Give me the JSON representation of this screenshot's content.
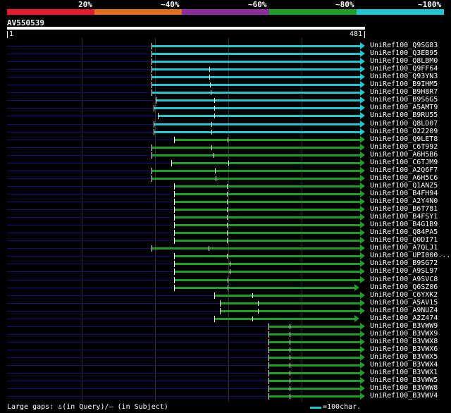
{
  "scale": {
    "labels": [
      "20%",
      "~40%",
      "~60%",
      "~80%",
      "~100%"
    ],
    "colors": [
      "#e8182d",
      "#e0701e",
      "#8c2e9e",
      "#1e9e28",
      "#1ec8d2"
    ]
  },
  "query": {
    "id": "AV550539",
    "start": "1",
    "end": "481",
    "length": 481
  },
  "colors": {
    "cyan": "#1ec8d2",
    "green": "#1e9e28",
    "row_line": "#12126e"
  },
  "hits": [
    {
      "label": "UniRef100_Q9SG83",
      "start": 195,
      "end": 481,
      "color": "cyan",
      "arrow": true,
      "gaps": []
    },
    {
      "label": "UniRef100_Q3EB95",
      "start": 195,
      "end": 481,
      "color": "cyan",
      "arrow": true,
      "gaps": []
    },
    {
      "label": "UniRef100_Q8LBM0",
      "start": 195,
      "end": 481,
      "color": "cyan",
      "arrow": true,
      "gaps": []
    },
    {
      "label": "UniRef100_Q9FF64",
      "start": 195,
      "end": 481,
      "color": "cyan",
      "arrow": true,
      "gaps": [
        273
      ]
    },
    {
      "label": "UniRef100_Q93YN3",
      "start": 195,
      "end": 481,
      "color": "cyan",
      "arrow": true,
      "gaps": [
        273
      ]
    },
    {
      "label": "UniRef100_B9IHM5",
      "start": 195,
      "end": 481,
      "color": "cyan",
      "arrow": true,
      "gaps": [
        274
      ]
    },
    {
      "label": "UniRef100_B9H8R7",
      "start": 195,
      "end": 481,
      "color": "cyan",
      "arrow": true,
      "gaps": [
        275
      ]
    },
    {
      "label": "UniRef100_B9S6G5",
      "start": 201,
      "end": 481,
      "color": "cyan",
      "arrow": true,
      "gaps": [
        279
      ]
    },
    {
      "label": "UniRef100_A5AMT9",
      "start": 198,
      "end": 481,
      "color": "cyan",
      "arrow": true,
      "gaps": [
        279
      ]
    },
    {
      "label": "UniRef100_B9RU55",
      "start": 204,
      "end": 481,
      "color": "cyan",
      "arrow": true,
      "gaps": [
        279
      ]
    },
    {
      "label": "UniRef100_Q8LD07",
      "start": 198,
      "end": 481,
      "color": "cyan",
      "arrow": true,
      "gaps": [
        276
      ]
    },
    {
      "label": "UniRef100_O22209",
      "start": 198,
      "end": 481,
      "color": "cyan",
      "arrow": true,
      "gaps": [
        276
      ]
    },
    {
      "label": "UniRef100_Q9LET8",
      "start": 225,
      "end": 481,
      "color": "green",
      "arrow": true,
      "gaps": [
        297
      ]
    },
    {
      "label": "UniRef100_C6T992",
      "start": 195,
      "end": 481,
      "color": "green",
      "arrow": true,
      "gaps": [
        276
      ]
    },
    {
      "label": "UniRef100_A6H5B6",
      "start": 195,
      "end": 481,
      "color": "green",
      "arrow": true,
      "gaps": [
        278
      ]
    },
    {
      "label": "UniRef100_C6TJM9",
      "start": 222,
      "end": 481,
      "color": "green",
      "arrow": true,
      "gaps": [
        298
      ]
    },
    {
      "label": "UniRef100_A2Q6F7",
      "start": 195,
      "end": 481,
      "color": "green",
      "arrow": true,
      "gaps": [
        280
      ]
    },
    {
      "label": "UniRef100_A6H5C6",
      "start": 195,
      "end": 481,
      "color": "green",
      "arrow": true,
      "gaps": [
        281
      ]
    },
    {
      "label": "UniRef100_Q1ANZ5",
      "start": 225,
      "end": 481,
      "color": "green",
      "arrow": true,
      "gaps": [
        296
      ]
    },
    {
      "label": "UniRef100_B4FH94",
      "start": 225,
      "end": 481,
      "color": "green",
      "arrow": true,
      "gaps": [
        296
      ]
    },
    {
      "label": "UniRef100_A2Y4N0",
      "start": 225,
      "end": 481,
      "color": "green",
      "arrow": true,
      "gaps": [
        296
      ]
    },
    {
      "label": "UniRef100_B6T781",
      "start": 225,
      "end": 481,
      "color": "green",
      "arrow": true,
      "gaps": [
        296
      ]
    },
    {
      "label": "UniRef100_B4FSY1",
      "start": 225,
      "end": 481,
      "color": "green",
      "arrow": true,
      "gaps": [
        296
      ]
    },
    {
      "label": "UniRef100_B4G1B9",
      "start": 225,
      "end": 481,
      "color": "green",
      "arrow": true,
      "gaps": [
        296
      ]
    },
    {
      "label": "UniRef100_Q84PA5",
      "start": 225,
      "end": 481,
      "color": "green",
      "arrow": true,
      "gaps": [
        296
      ]
    },
    {
      "label": "UniRef100_Q0DI71",
      "start": 225,
      "end": 481,
      "color": "green",
      "arrow": true,
      "gaps": [
        296
      ]
    },
    {
      "label": "UniRef100_A7QLJ1",
      "start": 195,
      "end": 481,
      "color": "green",
      "arrow": true,
      "gaps": [
        272
      ]
    },
    {
      "label": "UniRef100_UPI000...",
      "start": 225,
      "end": 481,
      "color": "green",
      "arrow": true,
      "gaps": [
        296
      ]
    },
    {
      "label": "UniRef100_B9SG72",
      "start": 225,
      "end": 481,
      "color": "green",
      "arrow": true,
      "gaps": [
        300
      ]
    },
    {
      "label": "UniRef100_A9SL97",
      "start": 225,
      "end": 481,
      "color": "green",
      "arrow": true,
      "gaps": [
        300
      ]
    },
    {
      "label": "UniRef100_A9SVC8",
      "start": 225,
      "end": 481,
      "color": "green",
      "arrow": true,
      "gaps": [
        297
      ]
    },
    {
      "label": "UniRef100_Q6SZ06",
      "start": 225,
      "end": 473,
      "color": "green",
      "arrow": true,
      "gaps": [
        297
      ]
    },
    {
      "label": "UniRef100_C6YXK2",
      "start": 279,
      "end": 481,
      "color": "green",
      "arrow": true,
      "gaps": [
        330
      ]
    },
    {
      "label": "UniRef100_A5AV15",
      "start": 287,
      "end": 481,
      "color": "green",
      "arrow": true,
      "gaps": [
        338
      ]
    },
    {
      "label": "UniRef100_A9NUZ4",
      "start": 287,
      "end": 481,
      "color": "green",
      "arrow": true,
      "gaps": [
        338
      ]
    },
    {
      "label": "UniRef100_A2Z474",
      "start": 279,
      "end": 473,
      "color": "green",
      "arrow": true,
      "gaps": [
        330
      ]
    },
    {
      "label": "UniRef100_B3VWW9",
      "start": 352,
      "end": 481,
      "color": "green",
      "arrow": true,
      "gaps": [
        381
      ]
    },
    {
      "label": "UniRef100_B3VWX9",
      "start": 352,
      "end": 481,
      "color": "green",
      "arrow": true,
      "gaps": [
        381
      ]
    },
    {
      "label": "UniRef100_B3VWX8",
      "start": 352,
      "end": 481,
      "color": "green",
      "arrow": true,
      "gaps": [
        381
      ]
    },
    {
      "label": "UniRef100_B3VWX6",
      "start": 352,
      "end": 481,
      "color": "green",
      "arrow": true,
      "gaps": [
        381
      ]
    },
    {
      "label": "UniRef100_B3VWX5",
      "start": 352,
      "end": 481,
      "color": "green",
      "arrow": true,
      "gaps": [
        381
      ]
    },
    {
      "label": "UniRef100_B3VWX4",
      "start": 352,
      "end": 481,
      "color": "green",
      "arrow": true,
      "gaps": [
        381
      ]
    },
    {
      "label": "UniRef100_B3VWX1",
      "start": 352,
      "end": 481,
      "color": "green",
      "arrow": true,
      "gaps": [
        381
      ]
    },
    {
      "label": "UniRef100_B3VWW5",
      "start": 352,
      "end": 481,
      "color": "green",
      "arrow": true,
      "gaps": [
        381
      ]
    },
    {
      "label": "UniRef100_B3VWW8",
      "start": 352,
      "end": 481,
      "color": "green",
      "arrow": true,
      "gaps": [
        381
      ]
    },
    {
      "label": "UniRef100_B3VWV4",
      "start": 352,
      "end": 481,
      "color": "green",
      "arrow": true,
      "gaps": [
        381
      ]
    }
  ],
  "legend": {
    "gaps_text": "Large gaps: ♙(in Query)/— (in Subject)",
    "scale_text": "=100char."
  }
}
